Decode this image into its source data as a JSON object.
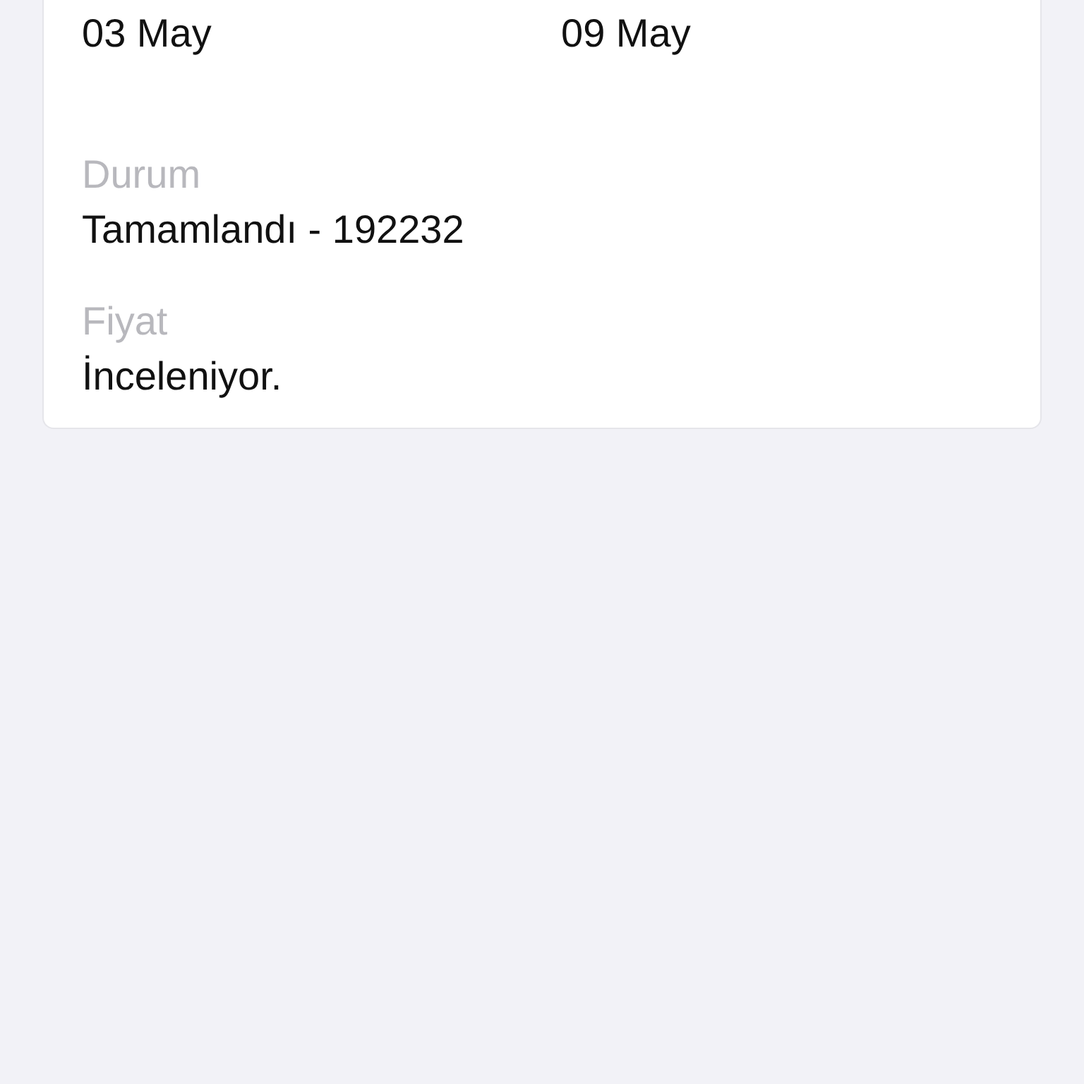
{
  "dates": [
    {
      "value": "03 May"
    },
    {
      "value": "09 May"
    }
  ],
  "fields": [
    {
      "label": "Durum",
      "value": "Tamamlandı - 192232"
    },
    {
      "label": "Fiyat",
      "value": "İnceleniyor."
    }
  ]
}
